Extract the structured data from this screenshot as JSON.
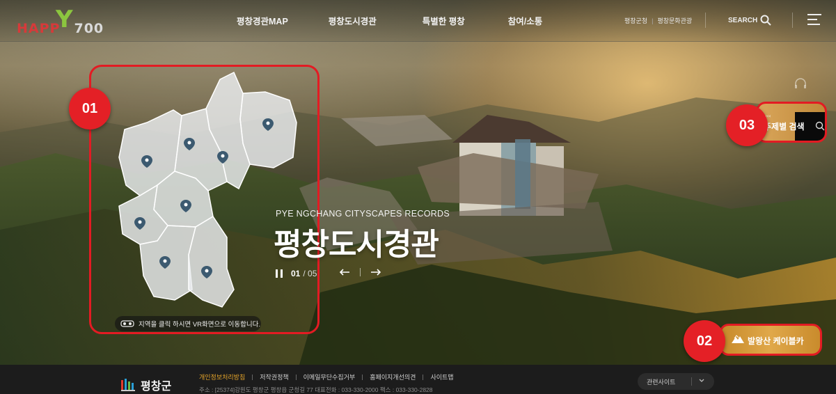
{
  "header": {
    "logo_text_happy": "HAPP",
    "logo_text_y": "Y",
    "logo_text_700": "700",
    "nav": [
      "평창경관MAP",
      "평창도시경관",
      "특별한 평창",
      "참여/소통"
    ],
    "util_links": [
      "평창군청",
      "평창문화관광"
    ],
    "search_label": "SEARCH"
  },
  "map": {
    "note": "지역을 클릭 하시면 VR화면으로 이동합니다."
  },
  "hero": {
    "subtitle": "PYE NGCHANG CITYSCAPES RECORDS",
    "title": "평창도시경관",
    "page_current": "01",
    "page_total": "/ 05"
  },
  "markers": [
    "01",
    "02",
    "03"
  ],
  "side": {
    "theme_search_label": "주제별 검색",
    "cable_car_label": "발왕산 케이블카"
  },
  "footer": {
    "logo_label": "평창군",
    "links": [
      "개인정보처리방침",
      "저작권정책",
      "이메일무단수집거부",
      "홈페이지개선의견",
      "사이트맵"
    ],
    "address": "주소 : [25374]강원도 평창군 평창읍 군청길 77 대표전화 : 033-330-2000 팩스 : 033-330-2828",
    "related_sites": "관련사이트"
  },
  "colors": {
    "marker_red": "#e42026",
    "footer_highlight": "#e6a52a",
    "logo_green": "#8cc63f"
  }
}
